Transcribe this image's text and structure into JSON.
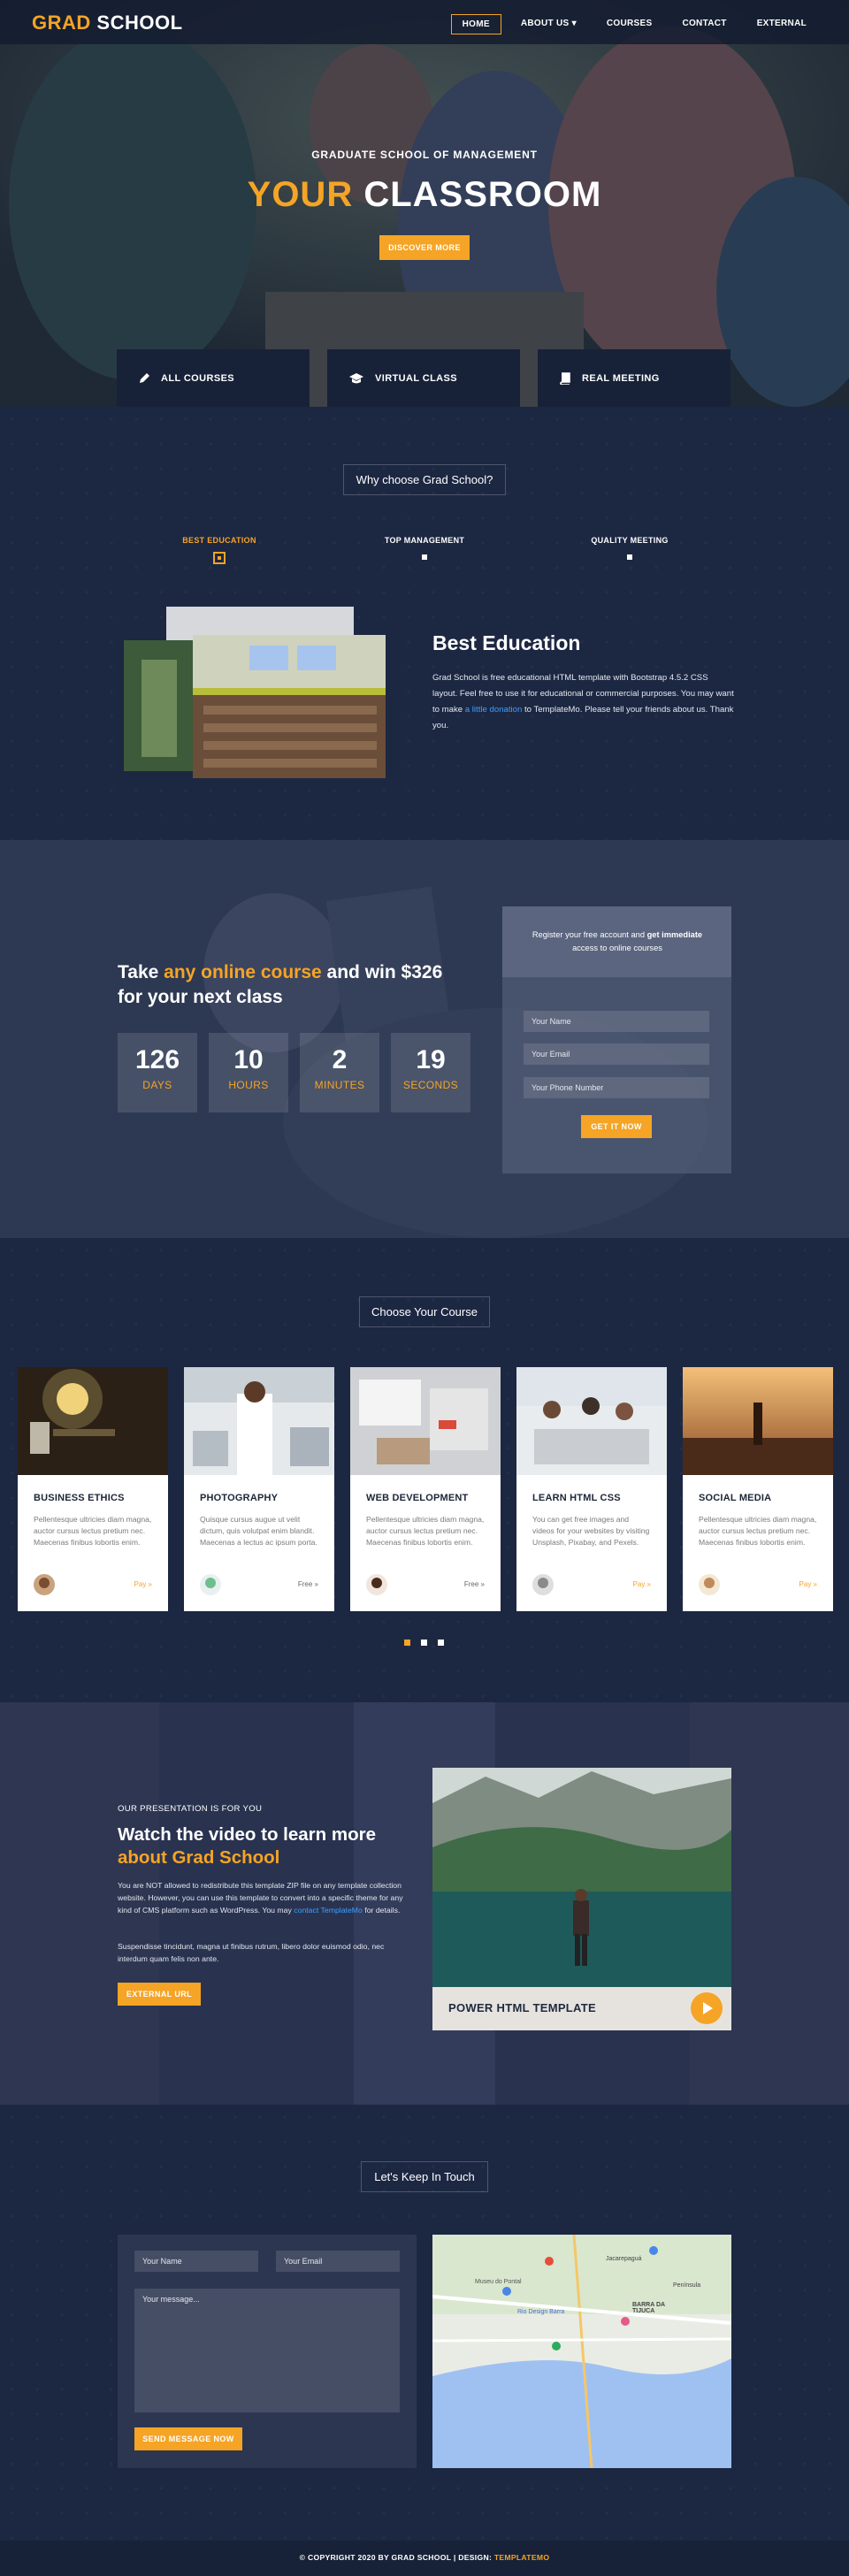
{
  "nav": {
    "brand_part1": "GRAD",
    "brand_part2": "SCHOOL",
    "links": [
      "HOME",
      "ABOUT US",
      "COURSES",
      "CONTACT",
      "EXTERNAL"
    ],
    "about_caret": "▾"
  },
  "hero": {
    "subtitle": "GRADUATE SCHOOL OF MANAGEMENT",
    "title_accent": "YOUR",
    "title_rest": "CLASSROOM",
    "button": "DISCOVER MORE"
  },
  "features": [
    {
      "label": "ALL COURSES",
      "icon": "pencil-icon"
    },
    {
      "label": "VIRTUAL CLASS",
      "icon": "graduation-cap-icon"
    },
    {
      "label": "REAL MEETING",
      "icon": "book-icon"
    }
  ],
  "why": {
    "heading": "Why choose Grad School?",
    "tabs": [
      "BEST EDUCATION",
      "TOP MANAGEMENT",
      "QUALITY MEETING"
    ],
    "content_title": "Best Education",
    "content_p1": "Grad School is free educational HTML template with Bootstrap 4.5.2 CSS layout. Feel free to use it for educational or commercial purposes. You may want to make ",
    "content_link": "a little donation",
    "content_p2": " to TemplateMo. Please tell your friends about us. Thank you."
  },
  "promo": {
    "line1_a": "Take ",
    "line1_accent": "any online course",
    "line1_b": " and win $326",
    "line2": "for your next class",
    "counters": [
      {
        "value": "126",
        "label": "DAYS"
      },
      {
        "value": "10",
        "label": "HOURS"
      },
      {
        "value": "2",
        "label": "MINUTES"
      },
      {
        "value": "19",
        "label": "SECONDS"
      }
    ],
    "form_intro_a": "Register your free account and ",
    "form_intro_bold": "get immediate",
    "form_intro_b": "access to online courses",
    "fields": [
      "Your Name",
      "Your Email",
      "Your Phone Number"
    ],
    "button": "GET IT NOW"
  },
  "courses": {
    "heading": "Choose Your Course",
    "items": [
      {
        "title": "BUSINESS ETHICS",
        "text": "Pellentesque ultricies diam magna, auctor cursus lectus pretium nec. Maecenas finibus lobortis enim.",
        "price": "Pay »"
      },
      {
        "title": "PHOTOGRAPHY",
        "text": "Quisque cursus augue ut velit dictum, quis volutpat enim blandit. Maecenas a lectus ac ipsum porta.",
        "price": "Free »"
      },
      {
        "title": "WEB DEVELOPMENT",
        "text": "Pellentesque ultricies diam magna, auctor cursus lectus pretium nec. Maecenas finibus lobortis enim.",
        "price": "Free »"
      },
      {
        "title": "LEARN HTML CSS",
        "text": "You can get free images and videos for your websites by visiting Unsplash, Pixabay, and Pexels.",
        "price": "Pay »"
      },
      {
        "title": "SOCIAL MEDIA",
        "text": "Pellentesque ultricies diam magna, auctor cursus lectus pretium nec. Maecenas finibus lobortis enim.",
        "price": "Pay »"
      }
    ]
  },
  "video": {
    "kicker": "OUR PRESENTATION IS FOR YOU",
    "title_a": "Watch the video to learn more",
    "title_accent": "about Grad School",
    "p1_a": "You are NOT allowed to redistribute this template ZIP file on any template collection website. However, you can use this template to convert into a specific theme for any kind of CMS platform such as WordPress. You may ",
    "p1_link1": "contact",
    "p1_link2": "TemplateMo",
    "p1_b": " for details.",
    "p2": "Suspendisse tincidunt, magna ut finibus rutrum, libero dolor euismod odio, nec interdum quam felis non ante.",
    "button": "EXTERNAL URL",
    "caption": "POWER HTML TEMPLATE"
  },
  "contact": {
    "heading": "Let's Keep In Touch",
    "name_ph": "Your Name",
    "email_ph": "Your Email",
    "msg_ph": "Your message...",
    "button": "SEND MESSAGE NOW"
  },
  "map": {
    "labels": [
      "Museu do Pontal",
      "Rio Design Barra",
      "BARRA DA TIJUCA",
      "Jacarepaguá",
      "Península"
    ]
  },
  "footer": {
    "text": "© COPYRIGHT 2020 BY GRAD SCHOOL | DESIGN: ",
    "link": "TEMPLATEMO"
  },
  "colors": {
    "accent": "#f5a425",
    "navy": "#172238",
    "link": "#3f9fff"
  }
}
